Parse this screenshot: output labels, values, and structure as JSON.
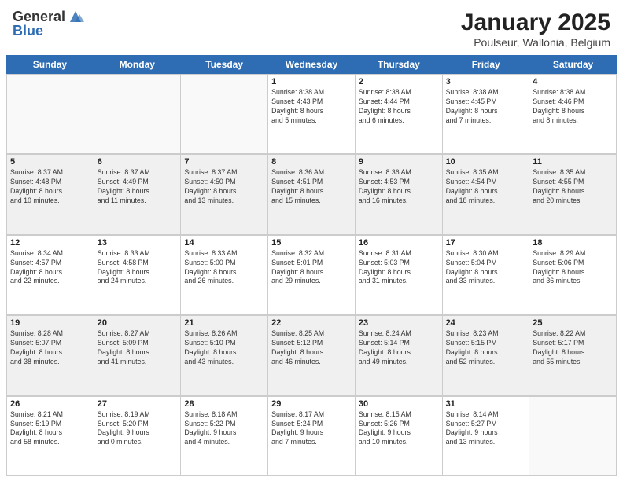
{
  "header": {
    "logo_general": "General",
    "logo_blue": "Blue",
    "month_title": "January 2025",
    "location": "Poulseur, Wallonia, Belgium"
  },
  "days_of_week": [
    "Sunday",
    "Monday",
    "Tuesday",
    "Wednesday",
    "Thursday",
    "Friday",
    "Saturday"
  ],
  "weeks": [
    [
      {
        "day": "",
        "info": "",
        "empty": true
      },
      {
        "day": "",
        "info": "",
        "empty": true
      },
      {
        "day": "",
        "info": "",
        "empty": true
      },
      {
        "day": "1",
        "info": "Sunrise: 8:38 AM\nSunset: 4:43 PM\nDaylight: 8 hours\nand 5 minutes."
      },
      {
        "day": "2",
        "info": "Sunrise: 8:38 AM\nSunset: 4:44 PM\nDaylight: 8 hours\nand 6 minutes."
      },
      {
        "day": "3",
        "info": "Sunrise: 8:38 AM\nSunset: 4:45 PM\nDaylight: 8 hours\nand 7 minutes."
      },
      {
        "day": "4",
        "info": "Sunrise: 8:38 AM\nSunset: 4:46 PM\nDaylight: 8 hours\nand 8 minutes."
      }
    ],
    [
      {
        "day": "5",
        "info": "Sunrise: 8:37 AM\nSunset: 4:48 PM\nDaylight: 8 hours\nand 10 minutes."
      },
      {
        "day": "6",
        "info": "Sunrise: 8:37 AM\nSunset: 4:49 PM\nDaylight: 8 hours\nand 11 minutes."
      },
      {
        "day": "7",
        "info": "Sunrise: 8:37 AM\nSunset: 4:50 PM\nDaylight: 8 hours\nand 13 minutes."
      },
      {
        "day": "8",
        "info": "Sunrise: 8:36 AM\nSunset: 4:51 PM\nDaylight: 8 hours\nand 15 minutes."
      },
      {
        "day": "9",
        "info": "Sunrise: 8:36 AM\nSunset: 4:53 PM\nDaylight: 8 hours\nand 16 minutes."
      },
      {
        "day": "10",
        "info": "Sunrise: 8:35 AM\nSunset: 4:54 PM\nDaylight: 8 hours\nand 18 minutes."
      },
      {
        "day": "11",
        "info": "Sunrise: 8:35 AM\nSunset: 4:55 PM\nDaylight: 8 hours\nand 20 minutes."
      }
    ],
    [
      {
        "day": "12",
        "info": "Sunrise: 8:34 AM\nSunset: 4:57 PM\nDaylight: 8 hours\nand 22 minutes."
      },
      {
        "day": "13",
        "info": "Sunrise: 8:33 AM\nSunset: 4:58 PM\nDaylight: 8 hours\nand 24 minutes."
      },
      {
        "day": "14",
        "info": "Sunrise: 8:33 AM\nSunset: 5:00 PM\nDaylight: 8 hours\nand 26 minutes."
      },
      {
        "day": "15",
        "info": "Sunrise: 8:32 AM\nSunset: 5:01 PM\nDaylight: 8 hours\nand 29 minutes."
      },
      {
        "day": "16",
        "info": "Sunrise: 8:31 AM\nSunset: 5:03 PM\nDaylight: 8 hours\nand 31 minutes."
      },
      {
        "day": "17",
        "info": "Sunrise: 8:30 AM\nSunset: 5:04 PM\nDaylight: 8 hours\nand 33 minutes."
      },
      {
        "day": "18",
        "info": "Sunrise: 8:29 AM\nSunset: 5:06 PM\nDaylight: 8 hours\nand 36 minutes."
      }
    ],
    [
      {
        "day": "19",
        "info": "Sunrise: 8:28 AM\nSunset: 5:07 PM\nDaylight: 8 hours\nand 38 minutes."
      },
      {
        "day": "20",
        "info": "Sunrise: 8:27 AM\nSunset: 5:09 PM\nDaylight: 8 hours\nand 41 minutes."
      },
      {
        "day": "21",
        "info": "Sunrise: 8:26 AM\nSunset: 5:10 PM\nDaylight: 8 hours\nand 43 minutes."
      },
      {
        "day": "22",
        "info": "Sunrise: 8:25 AM\nSunset: 5:12 PM\nDaylight: 8 hours\nand 46 minutes."
      },
      {
        "day": "23",
        "info": "Sunrise: 8:24 AM\nSunset: 5:14 PM\nDaylight: 8 hours\nand 49 minutes."
      },
      {
        "day": "24",
        "info": "Sunrise: 8:23 AM\nSunset: 5:15 PM\nDaylight: 8 hours\nand 52 minutes."
      },
      {
        "day": "25",
        "info": "Sunrise: 8:22 AM\nSunset: 5:17 PM\nDaylight: 8 hours\nand 55 minutes."
      }
    ],
    [
      {
        "day": "26",
        "info": "Sunrise: 8:21 AM\nSunset: 5:19 PM\nDaylight: 8 hours\nand 58 minutes."
      },
      {
        "day": "27",
        "info": "Sunrise: 8:19 AM\nSunset: 5:20 PM\nDaylight: 9 hours\nand 0 minutes."
      },
      {
        "day": "28",
        "info": "Sunrise: 8:18 AM\nSunset: 5:22 PM\nDaylight: 9 hours\nand 4 minutes."
      },
      {
        "day": "29",
        "info": "Sunrise: 8:17 AM\nSunset: 5:24 PM\nDaylight: 9 hours\nand 7 minutes."
      },
      {
        "day": "30",
        "info": "Sunrise: 8:15 AM\nSunset: 5:26 PM\nDaylight: 9 hours\nand 10 minutes."
      },
      {
        "day": "31",
        "info": "Sunrise: 8:14 AM\nSunset: 5:27 PM\nDaylight: 9 hours\nand 13 minutes."
      },
      {
        "day": "",
        "info": "",
        "empty": true
      }
    ]
  ]
}
